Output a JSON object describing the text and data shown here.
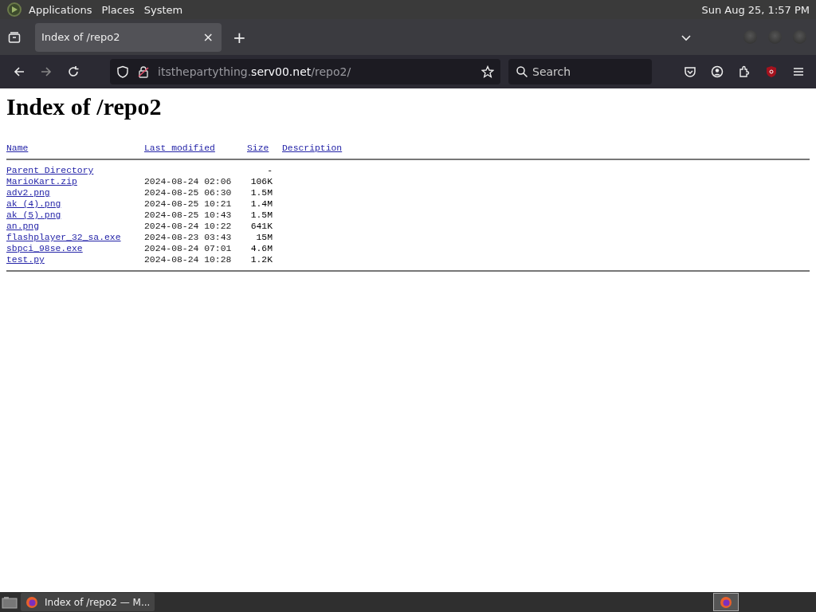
{
  "top_panel": {
    "menus": [
      "Applications",
      "Places",
      "System"
    ],
    "clock": "Sun Aug 25,  1:57 PM"
  },
  "browser": {
    "tabs": [
      {
        "title": "Index of /repo2",
        "close": "×",
        "selected": true
      }
    ],
    "new_tab": "+",
    "url": {
      "domain_prefix": "itsthepartything.",
      "domain": "serv00.net",
      "path": "/repo2/"
    },
    "search": {
      "placeholder": "Search"
    }
  },
  "page": {
    "heading": "Index of /repo2",
    "columns": [
      "Name",
      "Last modified",
      "Size",
      "Description"
    ],
    "rows": [
      {
        "name": "Parent Directory",
        "modified": "",
        "size": "-"
      },
      {
        "name": "MarioKart.zip",
        "modified": "2024-08-24 02:06",
        "size": "106K"
      },
      {
        "name": "adv2.png",
        "modified": "2024-08-25 06:30",
        "size": "1.5M"
      },
      {
        "name": "ak (4).png",
        "modified": "2024-08-25 10:21",
        "size": "1.4M"
      },
      {
        "name": "ak (5).png",
        "modified": "2024-08-25 10:43",
        "size": "1.5M"
      },
      {
        "name": "an.png",
        "modified": "2024-08-24 10:22",
        "size": "641K"
      },
      {
        "name": "flashplayer_32_sa.exe",
        "modified": "2024-08-23 03:43",
        "size": "15M"
      },
      {
        "name": "sbpci_98se.exe",
        "modified": "2024-08-24 07:01",
        "size": "4.6M"
      },
      {
        "name": "test.py",
        "modified": "2024-08-24 10:28",
        "size": "1.2K"
      }
    ]
  },
  "taskbar": {
    "windows": [
      {
        "title": "Index of /repo2 — M...",
        "selected": false
      }
    ]
  }
}
